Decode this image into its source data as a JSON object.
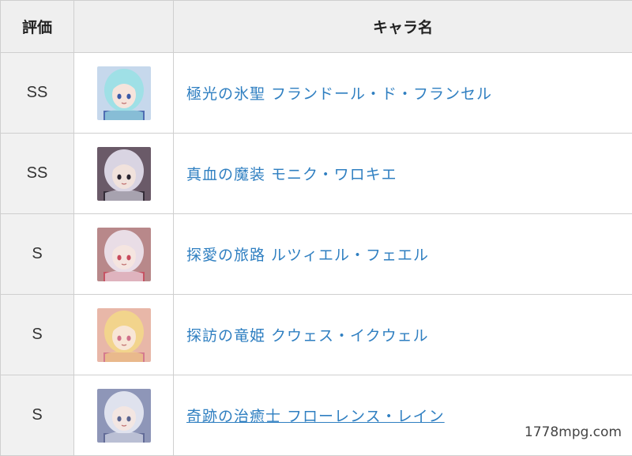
{
  "table": {
    "headers": {
      "rating": "評価",
      "image": "",
      "name": "キャラ名"
    },
    "rows": [
      {
        "rating": "SS",
        "name": "極光の氷聖 フランドール・ド・フランセル",
        "avatar": {
          "hair": "#9fe0e6",
          "skin": "#f6e4dc",
          "bg": "#c6d8ec",
          "accent": "#3a5aa8"
        }
      },
      {
        "rating": "SS",
        "name": "真血の魔装 モニク・ワロキエ",
        "avatar": {
          "hair": "#d9d4e2",
          "skin": "#f1e2dc",
          "bg": "#6a5a68",
          "accent": "#2a2430"
        }
      },
      {
        "rating": "S",
        "name": "探愛の旅路 ルツィエル・フェエル",
        "avatar": {
          "hair": "#e9dde6",
          "skin": "#f5e5e0",
          "bg": "#b8888a",
          "accent": "#c84a5c"
        }
      },
      {
        "rating": "S",
        "name": "探訪の竜姫 クウェス・イクウェル",
        "avatar": {
          "hair": "#f2d48c",
          "skin": "#f8e6d6",
          "bg": "#e8b7a8",
          "accent": "#d0708a"
        }
      },
      {
        "rating": "S",
        "name": "奇跡の治癒士 フローレンス・レイン",
        "avatar": {
          "hair": "#dfe2ee",
          "skin": "#f3e6e2",
          "bg": "#8e96b8",
          "accent": "#5a6490"
        }
      }
    ]
  },
  "watermark": "1778mpg.com"
}
